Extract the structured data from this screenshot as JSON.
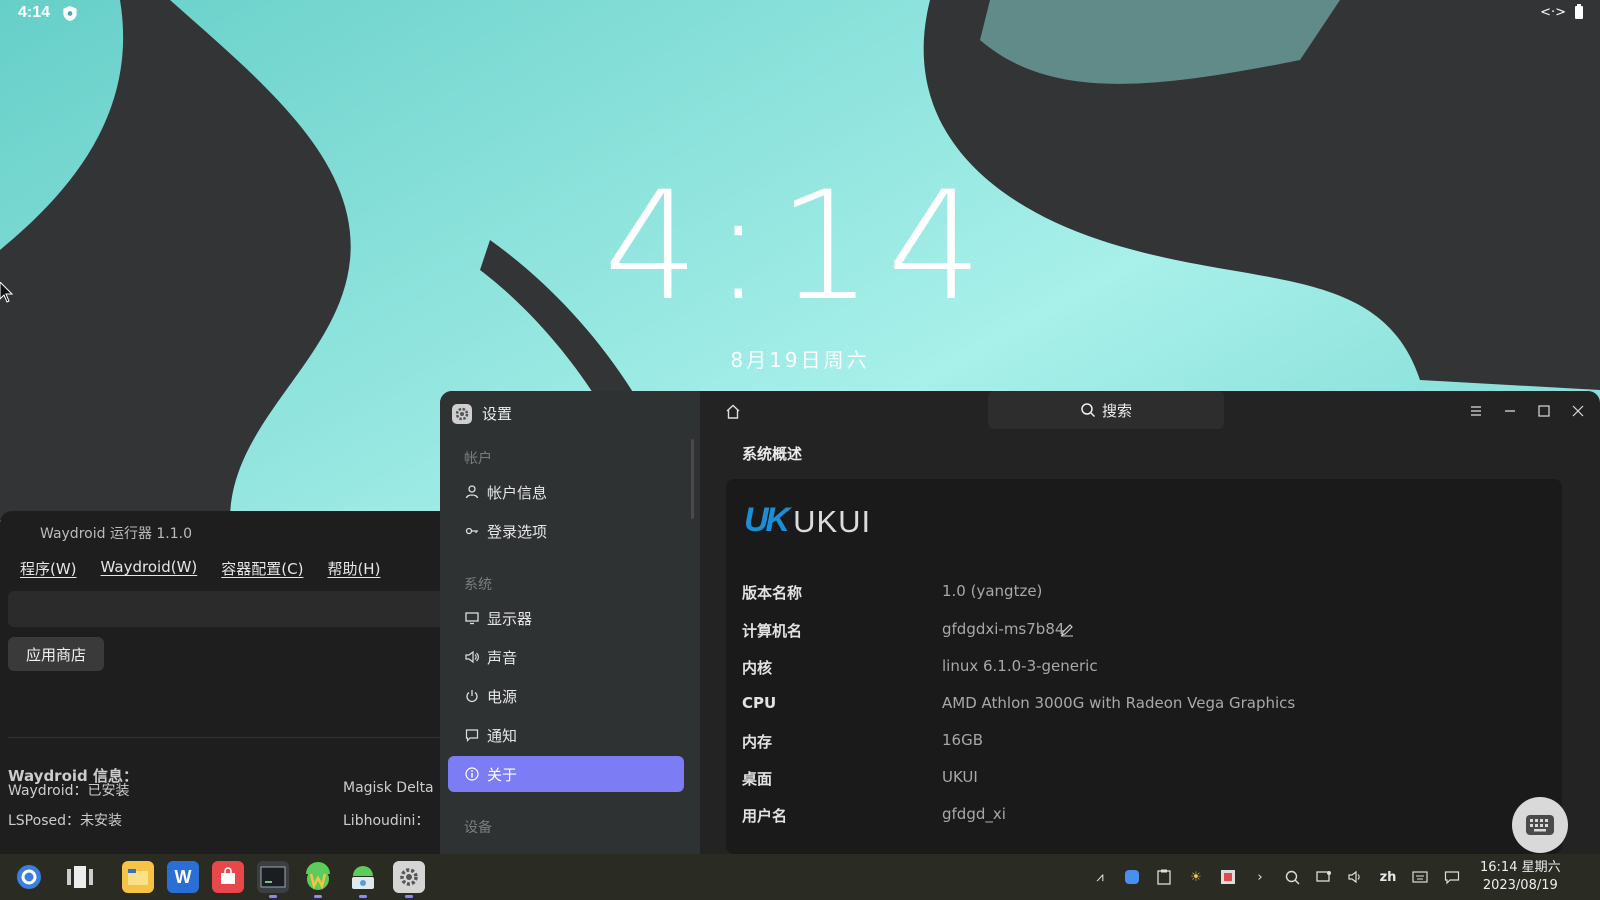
{
  "status_bar": {
    "time": "4:14"
  },
  "lockscreen": {
    "clock": "4:14",
    "date": "8月19日周六"
  },
  "waydroid": {
    "title": "Waydroid 运行器 1.1.0",
    "menu": [
      "程序(W)",
      "Waydroid(W)",
      "容器配置(C)",
      "帮助(H)"
    ],
    "store_button": "应用商店",
    "info_title": "Waydroid 信息：",
    "rows": {
      "waydroid": "Waydroid：已安装",
      "magisk": "Magisk Delta",
      "lsposed": "LSPosed：未安装",
      "libhoudini": "Libhoudini："
    }
  },
  "settings": {
    "app_title": "设置",
    "search_placeholder": "搜索",
    "sidebar": {
      "groups": [
        "帐户",
        "系统",
        "设备"
      ],
      "items": [
        {
          "label": "帐户信息",
          "icon": "user-icon"
        },
        {
          "label": "登录选项",
          "icon": "key-icon"
        },
        {
          "label": "显示器",
          "icon": "monitor-icon"
        },
        {
          "label": "声音",
          "icon": "speaker-icon"
        },
        {
          "label": "电源",
          "icon": "power-icon"
        },
        {
          "label": "通知",
          "icon": "message-icon"
        },
        {
          "label": "关于",
          "icon": "info-icon",
          "active": true
        }
      ]
    },
    "section_title": "系统概述",
    "logo_text": "UKUI",
    "info": [
      {
        "label": "版本名称",
        "value": "1.0 (yangtze)"
      },
      {
        "label": "计算机名",
        "value": "gfdgdxi-ms7b84"
      },
      {
        "label": "内核",
        "value": "linux 6.1.0-3-generic"
      },
      {
        "label": "CPU",
        "value": "AMD Athlon 3000G with Radeon Vega Graphics"
      },
      {
        "label": "内存",
        "value": "16GB"
      },
      {
        "label": "桌面",
        "value": "UKUI"
      },
      {
        "label": "用户名",
        "value": "gfdgd_xi"
      }
    ]
  },
  "taskbar": {
    "clock_time": "16:14 星期六",
    "clock_date": "2023/08/19",
    "lang": "zh"
  },
  "colors": {
    "accent": "#7c7cf5",
    "wallpaper_teal": "#6fd6cf",
    "wallpaper_dark": "#333436"
  }
}
